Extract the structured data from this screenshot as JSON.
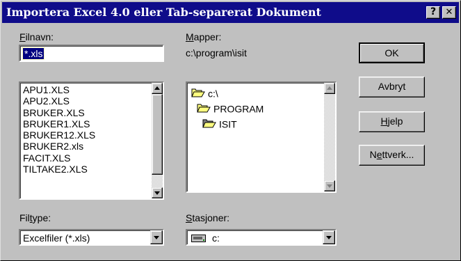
{
  "dialog": {
    "title": "Importera Excel 4.0 eller Tab-separerat Dokument",
    "help_button": "?",
    "close_button": "✕"
  },
  "filename": {
    "label_accel": "F",
    "label_rest": "ilnavn:",
    "value": "*.xls"
  },
  "files": [
    "APU1.XLS",
    "APU2.XLS",
    "BRUKER.XLS",
    "BRUKER1.XLS",
    "BRUKER12.XLS",
    "BRUKER2.xls",
    "FACIT.XLS",
    "TILTAKE2.XLS"
  ],
  "folders": {
    "label_accel": "M",
    "label_rest": "apper:",
    "current_path": "c:\\program\\isit",
    "tree": [
      {
        "name": "c:\\",
        "icon": "open-folder-icon"
      },
      {
        "name": "PROGRAM",
        "icon": "open-folder-icon"
      },
      {
        "name": "ISIT",
        "icon": "open-folder-selected-icon"
      }
    ]
  },
  "filetype": {
    "label_pre": "Fil",
    "label_accel": "t",
    "label_rest": "ype:",
    "value": "Excelfiler (*.xls)"
  },
  "drives": {
    "label_accel": "S",
    "label_rest": "tasjoner:",
    "value": "c:",
    "icon": "drive-icon"
  },
  "buttons": {
    "ok": "OK",
    "cancel": "Avbryt",
    "help_accel": "H",
    "help_rest": "jelp",
    "network_pre": "N",
    "network_accel": "e",
    "network_rest": "ttverk..."
  },
  "colors": {
    "titlebar": "#0f0c8a",
    "face": "#c0c0c0",
    "selection": "#000080"
  }
}
